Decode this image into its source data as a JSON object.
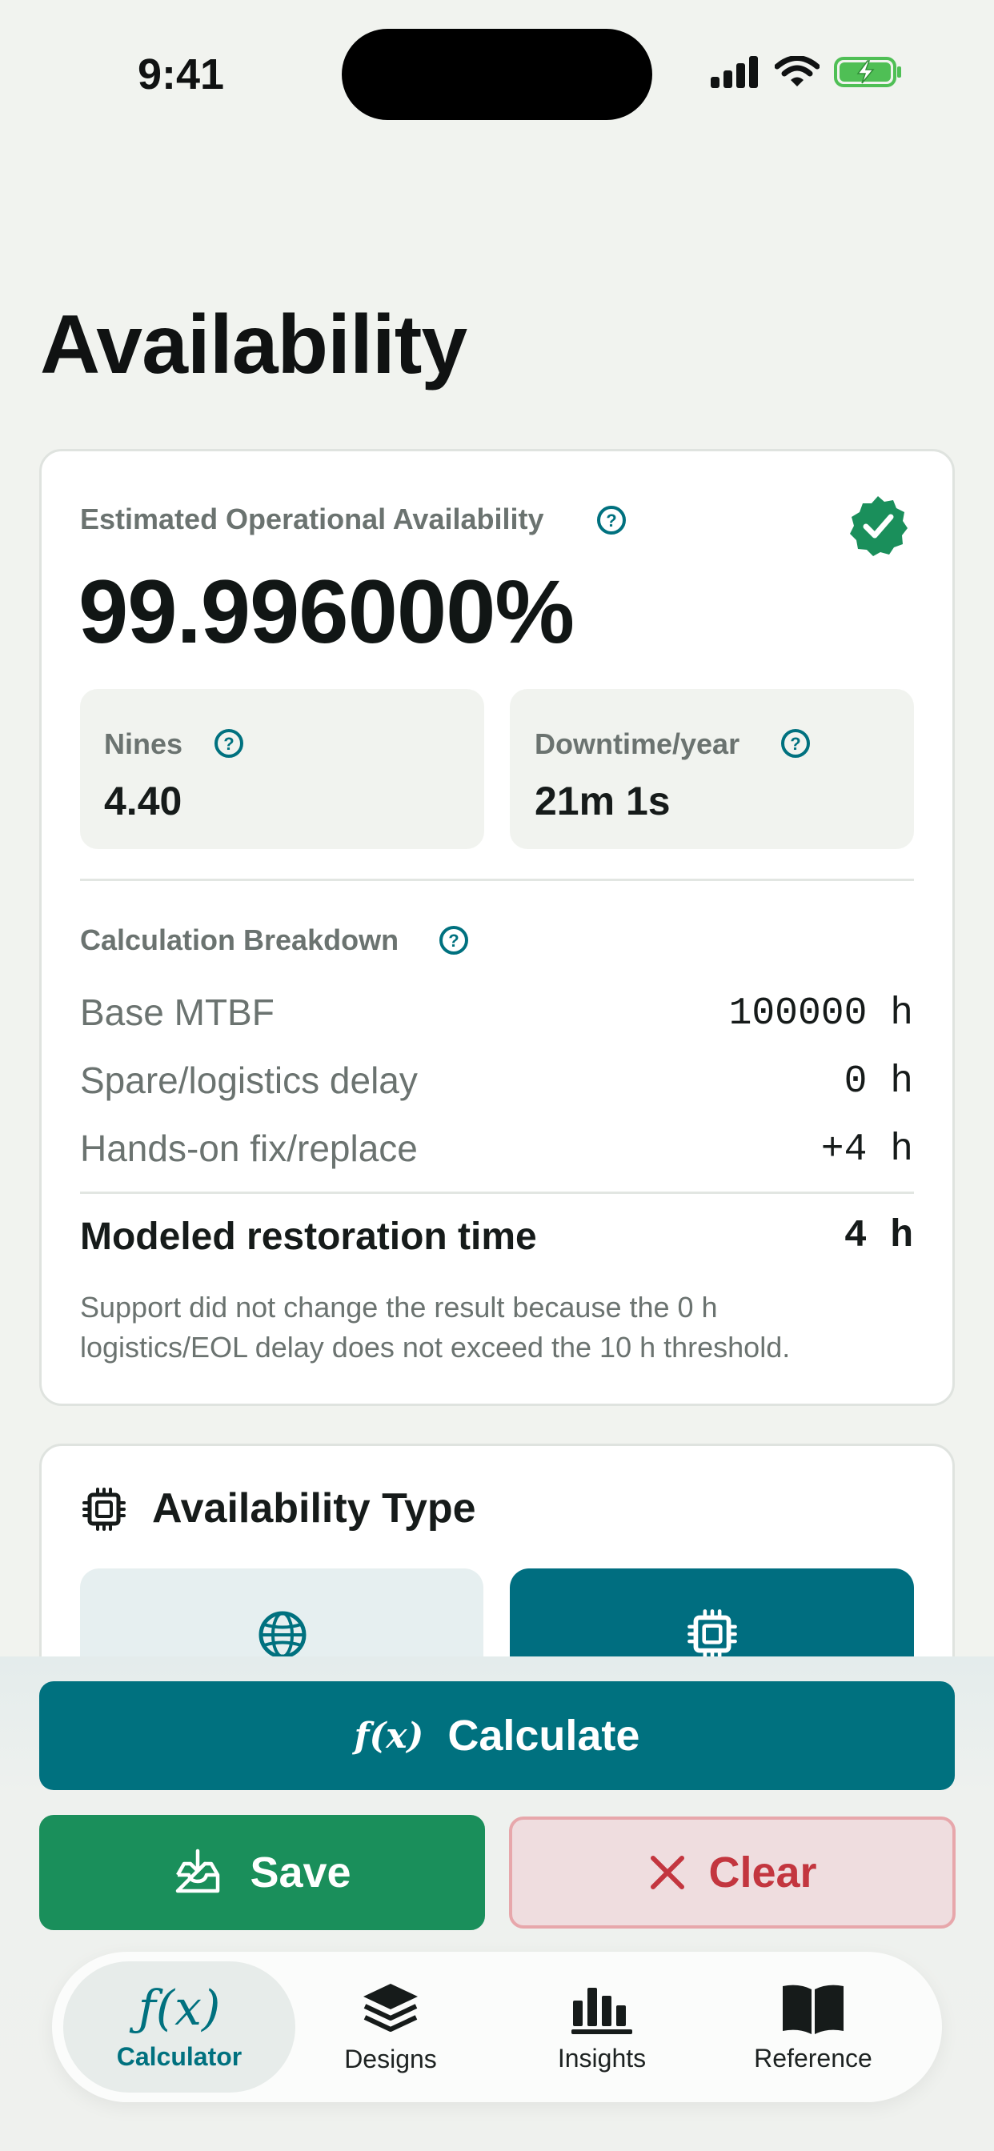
{
  "status_bar": {
    "time": "9:41",
    "icons": [
      "signal-icon",
      "wifi-icon",
      "battery-charging-icon"
    ]
  },
  "page": {
    "title": "Availability"
  },
  "result": {
    "label": "Estimated Operational Availability",
    "value": "99.996000%",
    "badge_icon": "verified-badge-icon",
    "tiles": [
      {
        "label": "Nines",
        "value": "4.40"
      },
      {
        "label": "Downtime/year",
        "value": "21m 1s"
      }
    ],
    "breakdown": {
      "title": "Calculation Breakdown",
      "rows": [
        {
          "label": "Base MTBF",
          "value": "100000 h"
        },
        {
          "label": "Spare/logistics delay",
          "value": "0 h"
        },
        {
          "label": "Hands-on fix/replace",
          "value": "+4 h"
        }
      ],
      "total": {
        "label": "Modeled restoration time",
        "value": "4 h"
      },
      "note_line1": "Support did not change the result because the 0 h",
      "note_line2": "logistics/EOL delay does not exceed the 10 h threshold."
    }
  },
  "availability_type": {
    "title": "Availability Type",
    "options": [
      {
        "icon": "globe-icon",
        "selected": false
      },
      {
        "icon": "chip-icon",
        "selected": true
      }
    ]
  },
  "actions": {
    "calculate_icon": "f(x)",
    "calculate_label": "Calculate",
    "save_label": "Save",
    "clear_label": "Clear"
  },
  "tabs": [
    {
      "label": "Calculator",
      "icon": "function-icon",
      "active": true
    },
    {
      "label": "Designs",
      "icon": "layers-icon",
      "active": false
    },
    {
      "label": "Insights",
      "icon": "bar-chart-icon",
      "active": false
    },
    {
      "label": "Reference",
      "icon": "book-icon",
      "active": false
    }
  ],
  "colors": {
    "primary": "#00717f",
    "success": "#1a8f5b",
    "danger": "#c3363f",
    "background": "#f1f3ef"
  }
}
